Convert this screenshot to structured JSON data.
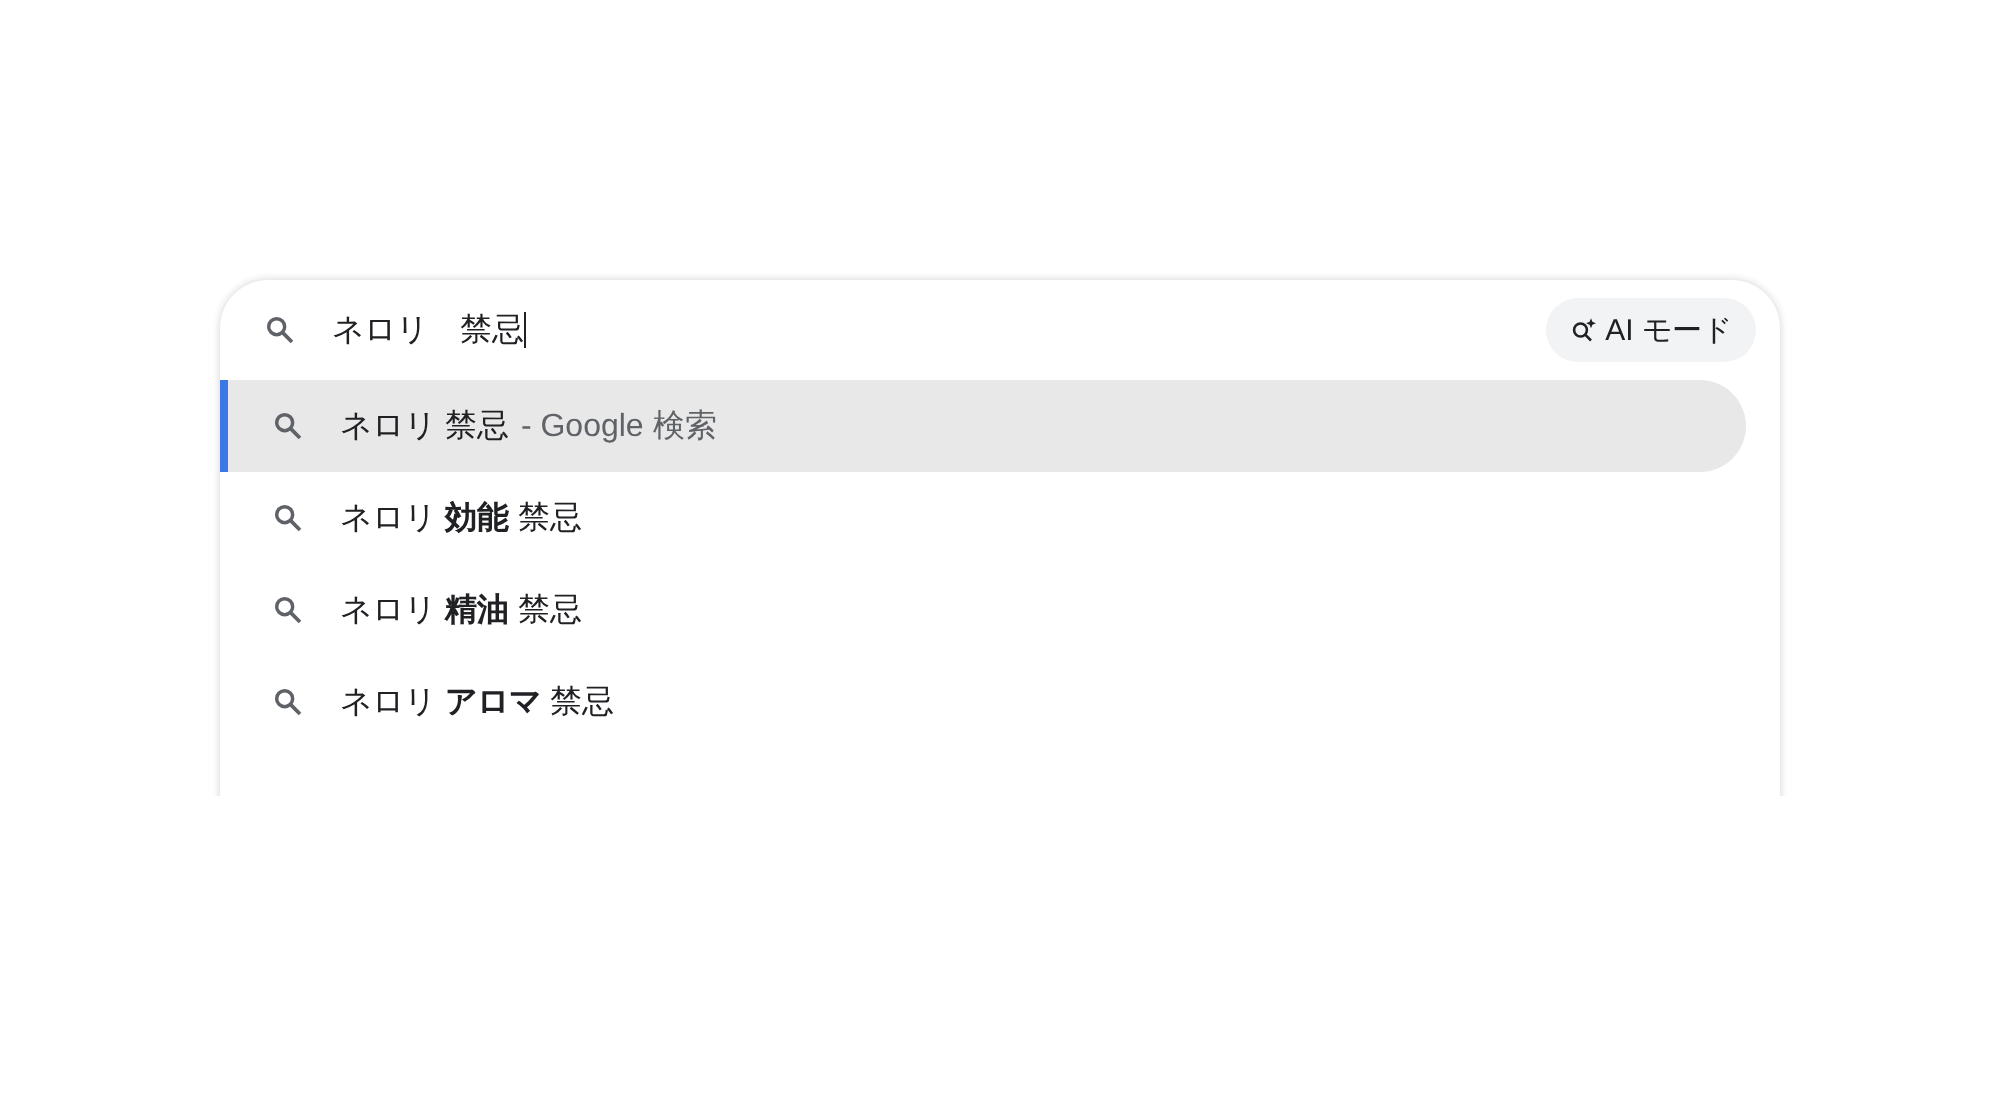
{
  "search": {
    "value": "ネロリ　禁忌",
    "ai_mode_label": "AI モード"
  },
  "suggestions": [
    {
      "text": "ネロリ 禁忌",
      "suffix": "- Google 検索",
      "selected": true
    },
    {
      "text": "ネロリ **効能** 禁忌",
      "selected": false
    },
    {
      "text": "ネロリ **精油** 禁忌",
      "selected": false
    },
    {
      "text": "ネロリ **アロマ** 禁忌",
      "selected": false
    }
  ]
}
